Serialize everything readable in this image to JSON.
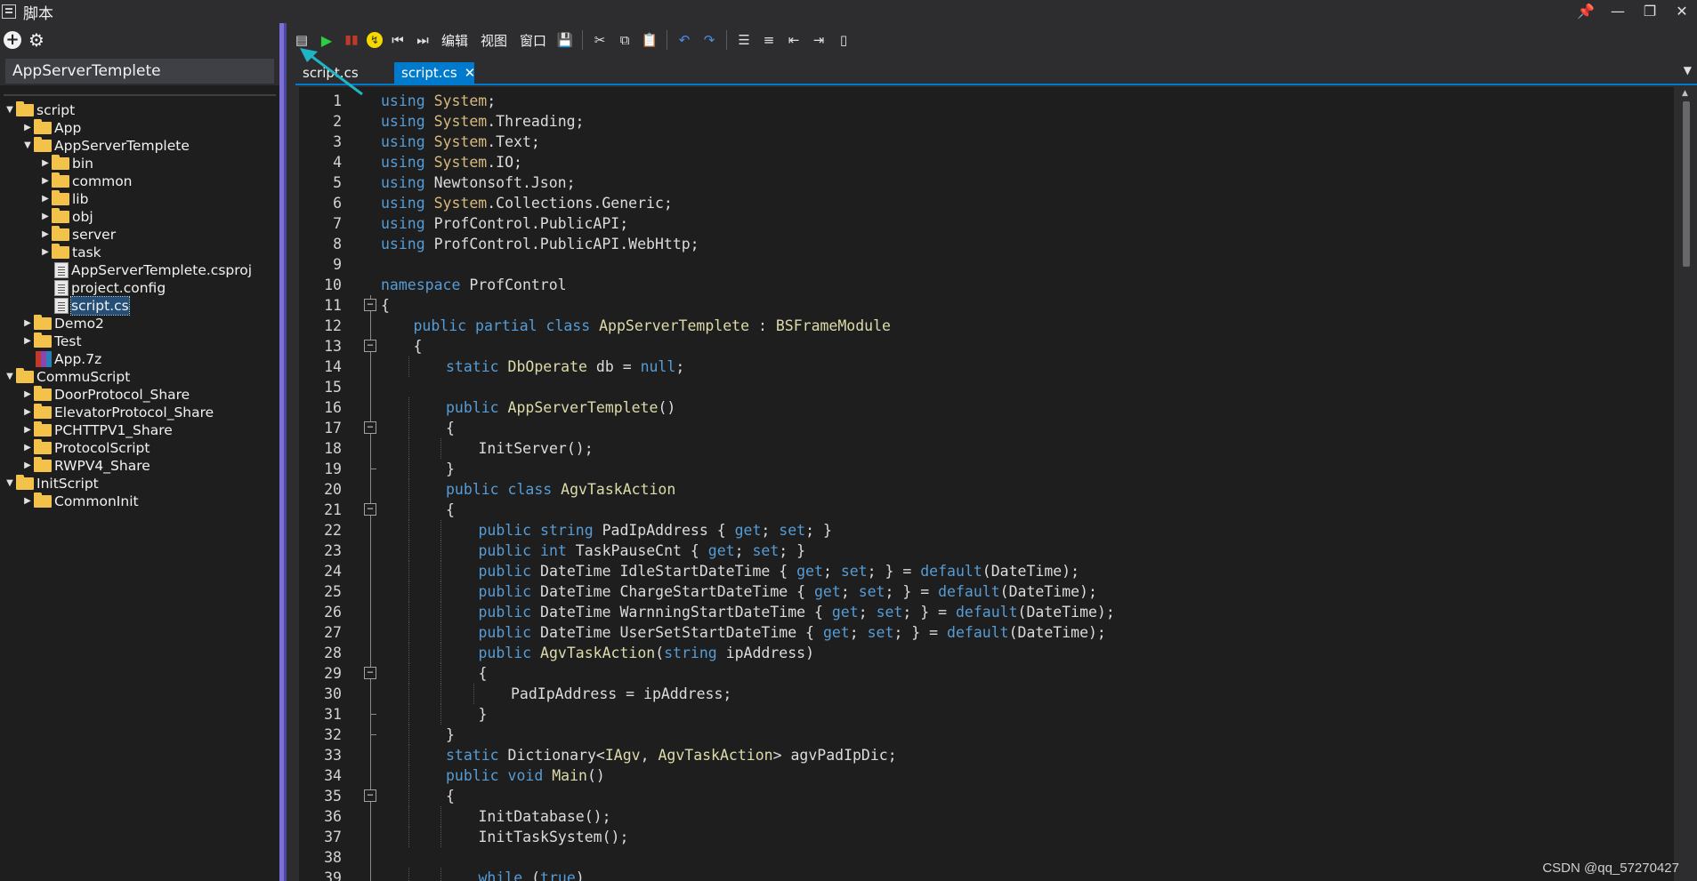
{
  "window": {
    "title": "脚本",
    "controls": [
      "pin-icon",
      "minimize-icon",
      "restore-icon",
      "close-icon"
    ]
  },
  "left_panel": {
    "toolbar": [
      "add-icon",
      "settings-icon"
    ],
    "project_name": "AppServerTemplete",
    "tree": [
      {
        "label": "script",
        "type": "folder",
        "level": 0,
        "expanded": true
      },
      {
        "label": "App",
        "type": "folder",
        "level": 1,
        "expanded": false
      },
      {
        "label": "AppServerTemplete",
        "type": "folder",
        "level": 1,
        "expanded": true
      },
      {
        "label": "bin",
        "type": "folder",
        "level": 2,
        "expanded": false
      },
      {
        "label": "common",
        "type": "folder",
        "level": 2,
        "expanded": false
      },
      {
        "label": "lib",
        "type": "folder",
        "level": 2,
        "expanded": false
      },
      {
        "label": "obj",
        "type": "folder",
        "level": 2,
        "expanded": false
      },
      {
        "label": "server",
        "type": "folder",
        "level": 2,
        "expanded": false
      },
      {
        "label": "task",
        "type": "folder",
        "level": 2,
        "expanded": false
      },
      {
        "label": "AppServerTemplete.csproj",
        "type": "file",
        "level": 2
      },
      {
        "label": "project.config",
        "type": "file",
        "level": 2
      },
      {
        "label": "script.cs",
        "type": "file",
        "level": 2,
        "selected": true
      },
      {
        "label": "Demo2",
        "type": "folder",
        "level": 1,
        "expanded": false
      },
      {
        "label": "Test",
        "type": "folder",
        "level": 1,
        "expanded": false
      },
      {
        "label": "App.7z",
        "type": "zip",
        "level": 1
      },
      {
        "label": "CommuScript",
        "type": "folder",
        "level": 0,
        "expanded": true
      },
      {
        "label": "DoorProtocol_Share",
        "type": "folder",
        "level": 1,
        "expanded": false
      },
      {
        "label": "ElevatorProtocol_Share",
        "type": "folder",
        "level": 1,
        "expanded": false
      },
      {
        "label": "PCHTTPV1_Share",
        "type": "folder",
        "level": 1,
        "expanded": false
      },
      {
        "label": "ProtocolScript",
        "type": "folder",
        "level": 1,
        "expanded": false
      },
      {
        "label": "RWPV4_Share",
        "type": "folder",
        "level": 1,
        "expanded": false
      },
      {
        "label": "InitScript",
        "type": "folder",
        "level": 0,
        "expanded": true
      },
      {
        "label": "CommonInit",
        "type": "folder",
        "level": 1,
        "expanded": false
      }
    ]
  },
  "toolbar": {
    "menu_edit": "编辑",
    "menu_view": "视图",
    "menu_window": "窗口"
  },
  "tabs": [
    {
      "label": "script.cs",
      "active": false
    },
    {
      "label": "script.cs",
      "active": true,
      "close": "✕"
    }
  ],
  "editor": {
    "lines": [
      {
        "n": "1",
        "indent": 0,
        "tokens": [
          [
            "kw",
            "using"
          ],
          [
            "",
            " "
          ],
          [
            "ty",
            "System"
          ],
          [
            "",
            ";"
          ]
        ]
      },
      {
        "n": "2",
        "indent": 0,
        "tokens": [
          [
            "kw",
            "using"
          ],
          [
            "",
            " "
          ],
          [
            "ty",
            "System"
          ],
          [
            "",
            ".Threading;"
          ]
        ]
      },
      {
        "n": "3",
        "indent": 0,
        "tokens": [
          [
            "kw",
            "using"
          ],
          [
            "",
            " "
          ],
          [
            "ty",
            "System"
          ],
          [
            "",
            ".Text;"
          ]
        ]
      },
      {
        "n": "4",
        "indent": 0,
        "tokens": [
          [
            "kw",
            "using"
          ],
          [
            "",
            " "
          ],
          [
            "ty",
            "System"
          ],
          [
            "",
            ".IO;"
          ]
        ]
      },
      {
        "n": "5",
        "indent": 0,
        "tokens": [
          [
            "kw",
            "using"
          ],
          [
            "",
            " Newtonsoft.Json;"
          ]
        ]
      },
      {
        "n": "6",
        "indent": 0,
        "tokens": [
          [
            "kw",
            "using"
          ],
          [
            "",
            " "
          ],
          [
            "ty",
            "System"
          ],
          [
            "",
            ".Collections.Generic;"
          ]
        ]
      },
      {
        "n": "7",
        "indent": 0,
        "tokens": [
          [
            "kw",
            "using"
          ],
          [
            "",
            " ProfControl.PublicAPI;"
          ]
        ]
      },
      {
        "n": "8",
        "indent": 0,
        "tokens": [
          [
            "kw",
            "using"
          ],
          [
            "",
            " ProfControl.PublicAPI.WebHttp;"
          ]
        ]
      },
      {
        "n": "9",
        "indent": 0,
        "tokens": []
      },
      {
        "n": "10",
        "indent": 0,
        "tokens": [
          [
            "kw",
            "namespace"
          ],
          [
            "",
            " ProfControl"
          ]
        ]
      },
      {
        "n": "11",
        "indent": 0,
        "fold": "open",
        "tokens": [
          [
            "",
            "{"
          ]
        ]
      },
      {
        "n": "12",
        "indent": 1,
        "tokens": [
          [
            "kw",
            "public partial class"
          ],
          [
            "",
            " "
          ],
          [
            "cls",
            "AppServerTemplete"
          ],
          [
            "",
            " : "
          ],
          [
            "cls",
            "BSFrameModule"
          ]
        ]
      },
      {
        "n": "13",
        "indent": 1,
        "fold": "open",
        "tokens": [
          [
            "",
            "{"
          ]
        ]
      },
      {
        "n": "14",
        "indent": 2,
        "tokens": [
          [
            "kw",
            "static"
          ],
          [
            "",
            " "
          ],
          [
            "cls",
            "DbOperate"
          ],
          [
            "",
            " db = "
          ],
          [
            "kw",
            "null"
          ],
          [
            "",
            ";"
          ]
        ]
      },
      {
        "n": "15",
        "indent": 0,
        "tokens": []
      },
      {
        "n": "16",
        "indent": 2,
        "tokens": [
          [
            "kw",
            "public"
          ],
          [
            "",
            " "
          ],
          [
            "cls",
            "AppServerTemplete"
          ],
          [
            "",
            "()"
          ]
        ]
      },
      {
        "n": "17",
        "indent": 2,
        "fold": "open",
        "tokens": [
          [
            "",
            "{"
          ]
        ]
      },
      {
        "n": "18",
        "indent": 3,
        "tokens": [
          [
            "",
            "InitServer();"
          ]
        ]
      },
      {
        "n": "19",
        "indent": 2,
        "fold": "end",
        "tokens": [
          [
            "",
            "}"
          ]
        ]
      },
      {
        "n": "20",
        "indent": 2,
        "tokens": [
          [
            "kw",
            "public class"
          ],
          [
            "",
            " "
          ],
          [
            "cls",
            "AgvTaskAction"
          ]
        ]
      },
      {
        "n": "21",
        "indent": 2,
        "fold": "open",
        "tokens": [
          [
            "",
            "{"
          ]
        ]
      },
      {
        "n": "22",
        "indent": 3,
        "tokens": [
          [
            "kw",
            "public string"
          ],
          [
            "",
            " PadIpAddress { "
          ],
          [
            "kw",
            "get"
          ],
          [
            "",
            "; "
          ],
          [
            "kw",
            "set"
          ],
          [
            "",
            "; }"
          ]
        ]
      },
      {
        "n": "23",
        "indent": 3,
        "tokens": [
          [
            "kw",
            "public int"
          ],
          [
            "",
            " TaskPauseCnt { "
          ],
          [
            "kw",
            "get"
          ],
          [
            "",
            "; "
          ],
          [
            "kw",
            "set"
          ],
          [
            "",
            "; }"
          ]
        ]
      },
      {
        "n": "24",
        "indent": 3,
        "tokens": [
          [
            "kw",
            "public"
          ],
          [
            "",
            " DateTime IdleStartDateTime { "
          ],
          [
            "kw",
            "get"
          ],
          [
            "",
            "; "
          ],
          [
            "kw",
            "set"
          ],
          [
            "",
            "; } = "
          ],
          [
            "kw",
            "default"
          ],
          [
            "",
            "(DateTime);"
          ]
        ]
      },
      {
        "n": "25",
        "indent": 3,
        "tokens": [
          [
            "kw",
            "public"
          ],
          [
            "",
            " DateTime ChargeStartDateTime { "
          ],
          [
            "kw",
            "get"
          ],
          [
            "",
            "; "
          ],
          [
            "kw",
            "set"
          ],
          [
            "",
            "; } = "
          ],
          [
            "kw",
            "default"
          ],
          [
            "",
            "(DateTime);"
          ]
        ]
      },
      {
        "n": "26",
        "indent": 3,
        "tokens": [
          [
            "kw",
            "public"
          ],
          [
            "",
            " DateTime WarnningStartDateTime { "
          ],
          [
            "kw",
            "get"
          ],
          [
            "",
            "; "
          ],
          [
            "kw",
            "set"
          ],
          [
            "",
            "; } = "
          ],
          [
            "kw",
            "default"
          ],
          [
            "",
            "(DateTime);"
          ]
        ]
      },
      {
        "n": "27",
        "indent": 3,
        "tokens": [
          [
            "kw",
            "public"
          ],
          [
            "",
            " DateTime UserSetStartDateTime { "
          ],
          [
            "kw",
            "get"
          ],
          [
            "",
            "; "
          ],
          [
            "kw",
            "set"
          ],
          [
            "",
            "; } = "
          ],
          [
            "kw",
            "default"
          ],
          [
            "",
            "(DateTime);"
          ]
        ]
      },
      {
        "n": "28",
        "indent": 3,
        "tokens": [
          [
            "kw",
            "public"
          ],
          [
            "",
            " "
          ],
          [
            "cls",
            "AgvTaskAction"
          ],
          [
            "",
            "("
          ],
          [
            "kw",
            "string"
          ],
          [
            "",
            " ipAddress)"
          ]
        ]
      },
      {
        "n": "29",
        "indent": 3,
        "fold": "open",
        "tokens": [
          [
            "",
            "{"
          ]
        ]
      },
      {
        "n": "30",
        "indent": 4,
        "tokens": [
          [
            "",
            "PadIpAddress = ipAddress;"
          ]
        ]
      },
      {
        "n": "31",
        "indent": 3,
        "fold": "end",
        "tokens": [
          [
            "",
            "}"
          ]
        ]
      },
      {
        "n": "32",
        "indent": 2,
        "fold": "end",
        "tokens": [
          [
            "",
            "}"
          ]
        ]
      },
      {
        "n": "33",
        "indent": 2,
        "tokens": [
          [
            "kw",
            "static"
          ],
          [
            "",
            " Dictionary<"
          ],
          [
            "cls",
            "IAgv"
          ],
          [
            "",
            ", "
          ],
          [
            "cls",
            "AgvTaskAction"
          ],
          [
            "",
            "> agvPadIpDic;"
          ]
        ]
      },
      {
        "n": "34",
        "indent": 2,
        "tokens": [
          [
            "kw",
            "public void"
          ],
          [
            "",
            " "
          ],
          [
            "cls",
            "Main"
          ],
          [
            "",
            "()"
          ]
        ]
      },
      {
        "n": "35",
        "indent": 2,
        "fold": "open",
        "tokens": [
          [
            "",
            "{"
          ]
        ]
      },
      {
        "n": "36",
        "indent": 3,
        "tokens": [
          [
            "",
            "InitDatabase();"
          ]
        ]
      },
      {
        "n": "37",
        "indent": 3,
        "tokens": [
          [
            "",
            "InitTaskSystem();"
          ]
        ]
      },
      {
        "n": "38",
        "indent": 0,
        "tokens": []
      },
      {
        "n": "39",
        "indent": 3,
        "tokens": [
          [
            "kw",
            "while"
          ],
          [
            "",
            " ("
          ],
          [
            "kw",
            "true"
          ],
          [
            "",
            ")"
          ]
        ]
      }
    ]
  },
  "watermark": "CSDN @qq_57270427",
  "colors": {
    "keyword": "#569cd6",
    "type": "#d7ba7d",
    "class": "#dcdcaa",
    "accent": "#007acc",
    "splitter": "#7b6fd8"
  }
}
